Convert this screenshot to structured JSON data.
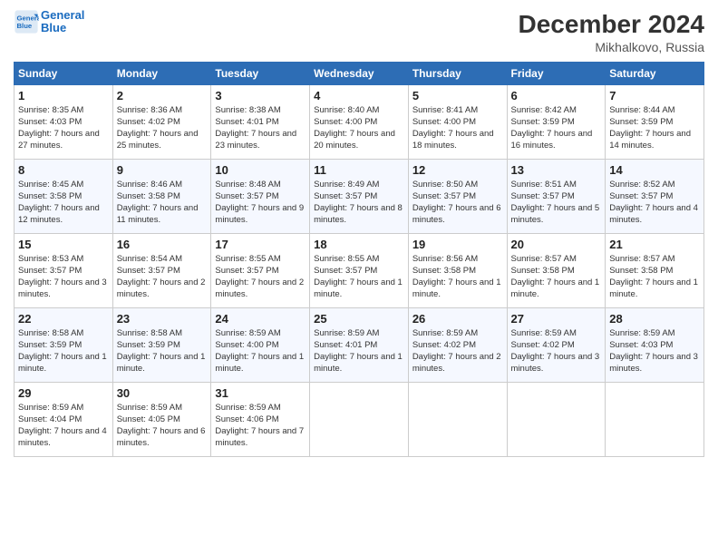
{
  "header": {
    "logo_line1": "General",
    "logo_line2": "Blue",
    "month": "December 2024",
    "location": "Mikhalkovo, Russia"
  },
  "days_of_week": [
    "Sunday",
    "Monday",
    "Tuesday",
    "Wednesday",
    "Thursday",
    "Friday",
    "Saturday"
  ],
  "weeks": [
    [
      {
        "day": "1",
        "sunrise": "8:35 AM",
        "sunset": "4:03 PM",
        "daylight": "7 hours and 27 minutes."
      },
      {
        "day": "2",
        "sunrise": "8:36 AM",
        "sunset": "4:02 PM",
        "daylight": "7 hours and 25 minutes."
      },
      {
        "day": "3",
        "sunrise": "8:38 AM",
        "sunset": "4:01 PM",
        "daylight": "7 hours and 23 minutes."
      },
      {
        "day": "4",
        "sunrise": "8:40 AM",
        "sunset": "4:00 PM",
        "daylight": "7 hours and 20 minutes."
      },
      {
        "day": "5",
        "sunrise": "8:41 AM",
        "sunset": "4:00 PM",
        "daylight": "7 hours and 18 minutes."
      },
      {
        "day": "6",
        "sunrise": "8:42 AM",
        "sunset": "3:59 PM",
        "daylight": "7 hours and 16 minutes."
      },
      {
        "day": "7",
        "sunrise": "8:44 AM",
        "sunset": "3:59 PM",
        "daylight": "7 hours and 14 minutes."
      }
    ],
    [
      {
        "day": "8",
        "sunrise": "8:45 AM",
        "sunset": "3:58 PM",
        "daylight": "7 hours and 12 minutes."
      },
      {
        "day": "9",
        "sunrise": "8:46 AM",
        "sunset": "3:58 PM",
        "daylight": "7 hours and 11 minutes."
      },
      {
        "day": "10",
        "sunrise": "8:48 AM",
        "sunset": "3:57 PM",
        "daylight": "7 hours and 9 minutes."
      },
      {
        "day": "11",
        "sunrise": "8:49 AM",
        "sunset": "3:57 PM",
        "daylight": "7 hours and 8 minutes."
      },
      {
        "day": "12",
        "sunrise": "8:50 AM",
        "sunset": "3:57 PM",
        "daylight": "7 hours and 6 minutes."
      },
      {
        "day": "13",
        "sunrise": "8:51 AM",
        "sunset": "3:57 PM",
        "daylight": "7 hours and 5 minutes."
      },
      {
        "day": "14",
        "sunrise": "8:52 AM",
        "sunset": "3:57 PM",
        "daylight": "7 hours and 4 minutes."
      }
    ],
    [
      {
        "day": "15",
        "sunrise": "8:53 AM",
        "sunset": "3:57 PM",
        "daylight": "7 hours and 3 minutes."
      },
      {
        "day": "16",
        "sunrise": "8:54 AM",
        "sunset": "3:57 PM",
        "daylight": "7 hours and 2 minutes."
      },
      {
        "day": "17",
        "sunrise": "8:55 AM",
        "sunset": "3:57 PM",
        "daylight": "7 hours and 2 minutes."
      },
      {
        "day": "18",
        "sunrise": "8:55 AM",
        "sunset": "3:57 PM",
        "daylight": "7 hours and 1 minute."
      },
      {
        "day": "19",
        "sunrise": "8:56 AM",
        "sunset": "3:58 PM",
        "daylight": "7 hours and 1 minute."
      },
      {
        "day": "20",
        "sunrise": "8:57 AM",
        "sunset": "3:58 PM",
        "daylight": "7 hours and 1 minute."
      },
      {
        "day": "21",
        "sunrise": "8:57 AM",
        "sunset": "3:58 PM",
        "daylight": "7 hours and 1 minute."
      }
    ],
    [
      {
        "day": "22",
        "sunrise": "8:58 AM",
        "sunset": "3:59 PM",
        "daylight": "7 hours and 1 minute."
      },
      {
        "day": "23",
        "sunrise": "8:58 AM",
        "sunset": "3:59 PM",
        "daylight": "7 hours and 1 minute."
      },
      {
        "day": "24",
        "sunrise": "8:59 AM",
        "sunset": "4:00 PM",
        "daylight": "7 hours and 1 minute."
      },
      {
        "day": "25",
        "sunrise": "8:59 AM",
        "sunset": "4:01 PM",
        "daylight": "7 hours and 1 minute."
      },
      {
        "day": "26",
        "sunrise": "8:59 AM",
        "sunset": "4:02 PM",
        "daylight": "7 hours and 2 minutes."
      },
      {
        "day": "27",
        "sunrise": "8:59 AM",
        "sunset": "4:02 PM",
        "daylight": "7 hours and 3 minutes."
      },
      {
        "day": "28",
        "sunrise": "8:59 AM",
        "sunset": "4:03 PM",
        "daylight": "7 hours and 3 minutes."
      }
    ],
    [
      {
        "day": "29",
        "sunrise": "8:59 AM",
        "sunset": "4:04 PM",
        "daylight": "7 hours and 4 minutes."
      },
      {
        "day": "30",
        "sunrise": "8:59 AM",
        "sunset": "4:05 PM",
        "daylight": "7 hours and 6 minutes."
      },
      {
        "day": "31",
        "sunrise": "8:59 AM",
        "sunset": "4:06 PM",
        "daylight": "7 hours and 7 minutes."
      },
      null,
      null,
      null,
      null
    ]
  ]
}
